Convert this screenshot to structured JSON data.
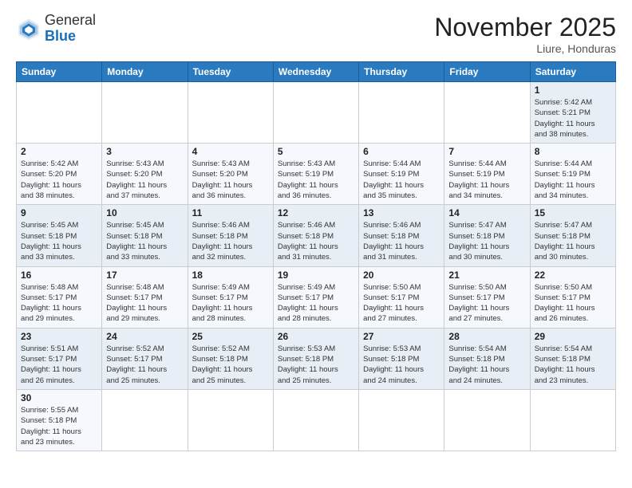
{
  "logo": {
    "text_general": "General",
    "text_blue": "Blue"
  },
  "header": {
    "month": "November 2025",
    "location": "Liure, Honduras"
  },
  "weekdays": [
    "Sunday",
    "Monday",
    "Tuesday",
    "Wednesday",
    "Thursday",
    "Friday",
    "Saturday"
  ],
  "weeks": [
    [
      {
        "day": "",
        "info": ""
      },
      {
        "day": "",
        "info": ""
      },
      {
        "day": "",
        "info": ""
      },
      {
        "day": "",
        "info": ""
      },
      {
        "day": "",
        "info": ""
      },
      {
        "day": "",
        "info": ""
      },
      {
        "day": "1",
        "info": "Sunrise: 5:42 AM\nSunset: 5:21 PM\nDaylight: 11 hours\nand 38 minutes."
      }
    ],
    [
      {
        "day": "2",
        "info": "Sunrise: 5:42 AM\nSunset: 5:20 PM\nDaylight: 11 hours\nand 38 minutes."
      },
      {
        "day": "3",
        "info": "Sunrise: 5:43 AM\nSunset: 5:20 PM\nDaylight: 11 hours\nand 37 minutes."
      },
      {
        "day": "4",
        "info": "Sunrise: 5:43 AM\nSunset: 5:20 PM\nDaylight: 11 hours\nand 36 minutes."
      },
      {
        "day": "5",
        "info": "Sunrise: 5:43 AM\nSunset: 5:19 PM\nDaylight: 11 hours\nand 36 minutes."
      },
      {
        "day": "6",
        "info": "Sunrise: 5:44 AM\nSunset: 5:19 PM\nDaylight: 11 hours\nand 35 minutes."
      },
      {
        "day": "7",
        "info": "Sunrise: 5:44 AM\nSunset: 5:19 PM\nDaylight: 11 hours\nand 34 minutes."
      },
      {
        "day": "8",
        "info": "Sunrise: 5:44 AM\nSunset: 5:19 PM\nDaylight: 11 hours\nand 34 minutes."
      }
    ],
    [
      {
        "day": "9",
        "info": "Sunrise: 5:45 AM\nSunset: 5:18 PM\nDaylight: 11 hours\nand 33 minutes."
      },
      {
        "day": "10",
        "info": "Sunrise: 5:45 AM\nSunset: 5:18 PM\nDaylight: 11 hours\nand 33 minutes."
      },
      {
        "day": "11",
        "info": "Sunrise: 5:46 AM\nSunset: 5:18 PM\nDaylight: 11 hours\nand 32 minutes."
      },
      {
        "day": "12",
        "info": "Sunrise: 5:46 AM\nSunset: 5:18 PM\nDaylight: 11 hours\nand 31 minutes."
      },
      {
        "day": "13",
        "info": "Sunrise: 5:46 AM\nSunset: 5:18 PM\nDaylight: 11 hours\nand 31 minutes."
      },
      {
        "day": "14",
        "info": "Sunrise: 5:47 AM\nSunset: 5:18 PM\nDaylight: 11 hours\nand 30 minutes."
      },
      {
        "day": "15",
        "info": "Sunrise: 5:47 AM\nSunset: 5:18 PM\nDaylight: 11 hours\nand 30 minutes."
      }
    ],
    [
      {
        "day": "16",
        "info": "Sunrise: 5:48 AM\nSunset: 5:17 PM\nDaylight: 11 hours\nand 29 minutes."
      },
      {
        "day": "17",
        "info": "Sunrise: 5:48 AM\nSunset: 5:17 PM\nDaylight: 11 hours\nand 29 minutes."
      },
      {
        "day": "18",
        "info": "Sunrise: 5:49 AM\nSunset: 5:17 PM\nDaylight: 11 hours\nand 28 minutes."
      },
      {
        "day": "19",
        "info": "Sunrise: 5:49 AM\nSunset: 5:17 PM\nDaylight: 11 hours\nand 28 minutes."
      },
      {
        "day": "20",
        "info": "Sunrise: 5:50 AM\nSunset: 5:17 PM\nDaylight: 11 hours\nand 27 minutes."
      },
      {
        "day": "21",
        "info": "Sunrise: 5:50 AM\nSunset: 5:17 PM\nDaylight: 11 hours\nand 27 minutes."
      },
      {
        "day": "22",
        "info": "Sunrise: 5:50 AM\nSunset: 5:17 PM\nDaylight: 11 hours\nand 26 minutes."
      }
    ],
    [
      {
        "day": "23",
        "info": "Sunrise: 5:51 AM\nSunset: 5:17 PM\nDaylight: 11 hours\nand 26 minutes."
      },
      {
        "day": "24",
        "info": "Sunrise: 5:52 AM\nSunset: 5:17 PM\nDaylight: 11 hours\nand 25 minutes."
      },
      {
        "day": "25",
        "info": "Sunrise: 5:52 AM\nSunset: 5:18 PM\nDaylight: 11 hours\nand 25 minutes."
      },
      {
        "day": "26",
        "info": "Sunrise: 5:53 AM\nSunset: 5:18 PM\nDaylight: 11 hours\nand 25 minutes."
      },
      {
        "day": "27",
        "info": "Sunrise: 5:53 AM\nSunset: 5:18 PM\nDaylight: 11 hours\nand 24 minutes."
      },
      {
        "day": "28",
        "info": "Sunrise: 5:54 AM\nSunset: 5:18 PM\nDaylight: 11 hours\nand 24 minutes."
      },
      {
        "day": "29",
        "info": "Sunrise: 5:54 AM\nSunset: 5:18 PM\nDaylight: 11 hours\nand 23 minutes."
      }
    ],
    [
      {
        "day": "30",
        "info": "Sunrise: 5:55 AM\nSunset: 5:18 PM\nDaylight: 11 hours\nand 23 minutes."
      },
      {
        "day": "",
        "info": ""
      },
      {
        "day": "",
        "info": ""
      },
      {
        "day": "",
        "info": ""
      },
      {
        "day": "",
        "info": ""
      },
      {
        "day": "",
        "info": ""
      },
      {
        "day": "",
        "info": ""
      }
    ]
  ]
}
